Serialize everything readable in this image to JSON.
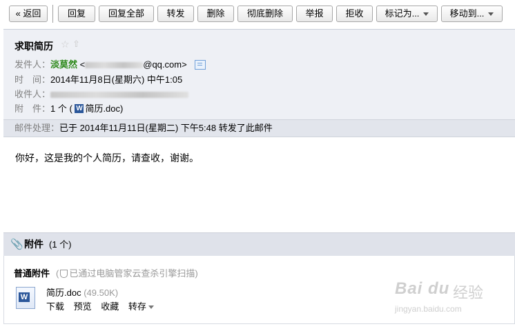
{
  "toolbar": {
    "back": "« 返回",
    "reply": "回复",
    "reply_all": "回复全部",
    "forward": "转发",
    "delete": "删除",
    "delete_permanent": "彻底删除",
    "report": "举报",
    "reject": "拒收",
    "mark_as": "标记为...",
    "move_to": "移动到..."
  },
  "mail": {
    "subject": "求职简历",
    "from_label": "发件人：",
    "from_name": "淡莫然",
    "from_email_domain": "@qq.com>",
    "time_label": "时　间：",
    "time": "2014年11月8日(星期六) 中午1:05",
    "to_label": "收件人：",
    "attach_label": "附　件：",
    "attach_count": "1 个 (",
    "attach_file": "简历.doc",
    "attach_close": ")",
    "process_label": "邮件处理：",
    "process_text": "已于 2014年11月11日(星期二) 下午5:48 转发了此邮件",
    "body": "你好，这是我的个人简历，请查收，谢谢。"
  },
  "attachments": {
    "title": "附件",
    "count": "(1 个)",
    "category": "普通附件",
    "scan_text": "已通过电脑管家云查杀引擎扫描)",
    "scan_open": "(",
    "file_name": "简历.doc",
    "file_size": "(49.50K)",
    "actions": [
      "下载",
      "预览",
      "收藏",
      "转存"
    ]
  },
  "watermark": {
    "logo": "Bai du",
    "cn": "经验",
    "url": "jingyan.baidu.com"
  },
  "colors": {
    "sender_name": "#2f8a1d",
    "header_bg": "#eef0f5",
    "attach_head_bg": "#dfe2ea"
  }
}
